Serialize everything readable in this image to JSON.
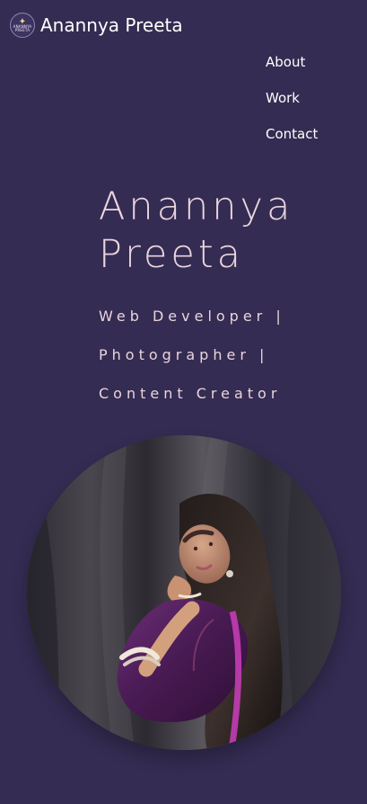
{
  "site": {
    "name": "Anannya Preeta",
    "logo_text": "ANANNYA\nPREETA"
  },
  "nav": {
    "about": "About",
    "work": "Work",
    "contact": "Contact"
  },
  "hero": {
    "title": "Anannya Preeta",
    "subtitle": "Web Developer | Photographer | Content Creator"
  },
  "colors": {
    "background": "#342c52",
    "title_text": "#ead4de",
    "nav_text": "#ffffff"
  },
  "icons": {
    "brand_logo": "star-logo-icon"
  }
}
